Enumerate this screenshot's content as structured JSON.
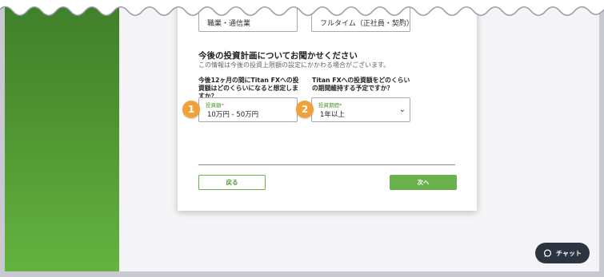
{
  "form": {
    "top_left_field": "職業・通信業",
    "top_right_field": "フルタイム（正社員・契約）",
    "section_title": "今後の投資計画についてお聞かせください",
    "section_subtitle": "この情報は今後の投資上限額の設定にかかわる場合がございます。",
    "question1": "今後12ヶ月の間にTitan FXへの投資額はどのくらいになると想定しますか？",
    "question2": "Titan FXへの投資額をどのくらいの期間維持する予定ですか？",
    "select1": {
      "label": "投資額",
      "required_mark": "*",
      "value": "10万円 - 50万円"
    },
    "select2": {
      "label": "投資期間",
      "required_mark": "*",
      "value": "1年以上"
    },
    "back_label": "戻る",
    "next_label": "次へ"
  },
  "annotations": {
    "badge1": "1",
    "badge2": "2"
  },
  "chat": {
    "label": "チャット"
  },
  "colors": {
    "brand_green": "#6ab04c",
    "badge_orange": "#f0a23a",
    "chat_dark": "#2b3440"
  },
  "icons": {
    "dropdown": "chevron-down-icon",
    "chat": "chat-bubble-icon"
  }
}
